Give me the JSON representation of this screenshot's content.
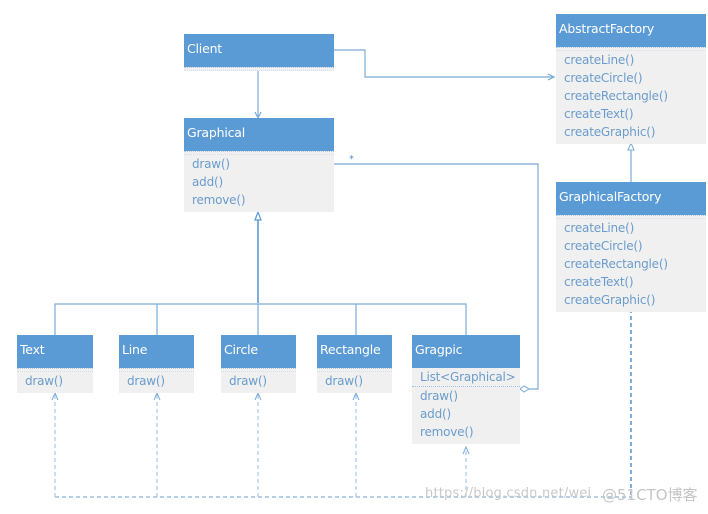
{
  "diagram": {
    "type": "UML class diagram",
    "classes": {
      "client": {
        "name": "Client",
        "methods": []
      },
      "graphical": {
        "name": "Graphical",
        "methods": [
          "draw()",
          "add()",
          "remove()"
        ]
      },
      "abstract_factory": {
        "name": "AbstractFactory",
        "methods": [
          "createLine()",
          "createCircle()",
          "createRectangle()",
          "createText()",
          "createGraphic()"
        ]
      },
      "graphical_factory": {
        "name": "GraphicalFactory",
        "methods": [
          "createLine()",
          "createCircle()",
          "createRectangle()",
          "createText()",
          "createGraphic()"
        ]
      },
      "text": {
        "name": "Text",
        "methods": [
          "draw()"
        ]
      },
      "line": {
        "name": "Line",
        "methods": [
          "draw()"
        ]
      },
      "circle": {
        "name": "Circle",
        "methods": [
          "draw()"
        ]
      },
      "rectangle": {
        "name": "Rectangle",
        "methods": [
          "draw()"
        ]
      },
      "gragpic": {
        "name": "Gragpic",
        "attributes": [
          "List<Graphical>"
        ],
        "methods": [
          "draw()",
          "add()",
          "remove()"
        ]
      }
    },
    "relations": [
      {
        "from": "Client",
        "to": "Graphical",
        "kind": "association"
      },
      {
        "from": "Client",
        "to": "AbstractFactory",
        "kind": "association"
      },
      {
        "from": "GraphicalFactory",
        "to": "AbstractFactory",
        "kind": "generalization"
      },
      {
        "from": "Text",
        "to": "Graphical",
        "kind": "generalization"
      },
      {
        "from": "Line",
        "to": "Graphical",
        "kind": "generalization"
      },
      {
        "from": "Circle",
        "to": "Graphical",
        "kind": "generalization"
      },
      {
        "from": "Rectangle",
        "to": "Graphical",
        "kind": "generalization"
      },
      {
        "from": "Gragpic",
        "to": "Graphical",
        "kind": "generalization"
      },
      {
        "from": "Gragpic",
        "to": "Graphical",
        "kind": "aggregation",
        "multiplicity": "*"
      },
      {
        "from": "GraphicalFactory",
        "to": [
          "Text",
          "Line",
          "Circle",
          "Rectangle",
          "Gragpic"
        ],
        "kind": "dependency"
      }
    ],
    "multiplicity_label": "*",
    "colors": {
      "header": "#5b9bd5",
      "body": "#f0f0f0",
      "method_text": "#6a9ccc",
      "line": "#5b9bd5"
    }
  },
  "watermark": {
    "url": "https://blog.csdn.net/wei",
    "brand": "@51CTO博客"
  }
}
